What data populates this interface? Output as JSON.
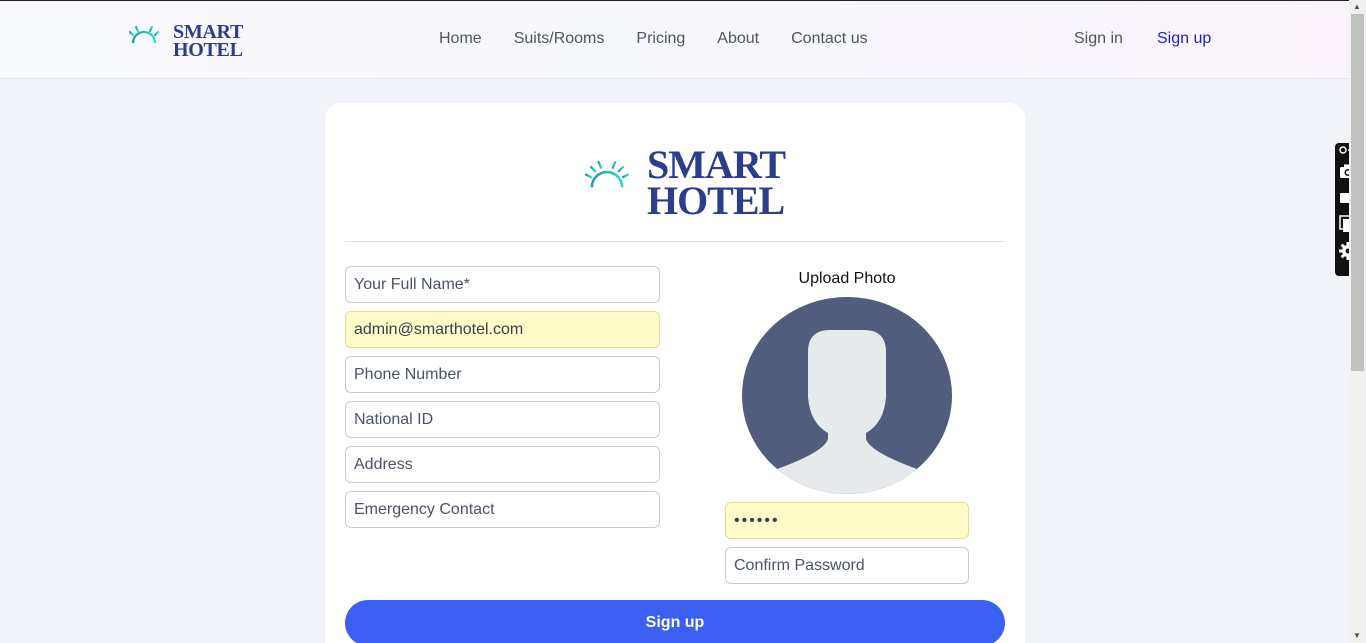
{
  "brand": {
    "line1": "SMART",
    "line2": "HOTEL",
    "colors": {
      "primary": "#2b3d8c",
      "accent": "#1fc7c2"
    }
  },
  "nav": {
    "items": [
      {
        "label": "Home"
      },
      {
        "label": "Suits/Rooms"
      },
      {
        "label": "Pricing"
      },
      {
        "label": "About"
      },
      {
        "label": "Contact us"
      }
    ]
  },
  "auth": {
    "signin": "Sign in",
    "signup": "Sign up"
  },
  "form": {
    "fullname_placeholder": "Your Full Name*",
    "email_value": "admin@smarthotel.com",
    "phone_placeholder": "Phone Number",
    "national_id_placeholder": "National ID",
    "address_placeholder": "Address",
    "emergency_placeholder": "Emergency Contact",
    "upload_label": "Upload Photo",
    "password_value": "123456",
    "confirm_placeholder": "Confirm Password",
    "submit_label": "Sign up",
    "submit_color": "#3a5ff2"
  },
  "widget": {
    "icons": [
      "camera-icon",
      "video-icon",
      "window-icon",
      "gear-icon"
    ]
  }
}
